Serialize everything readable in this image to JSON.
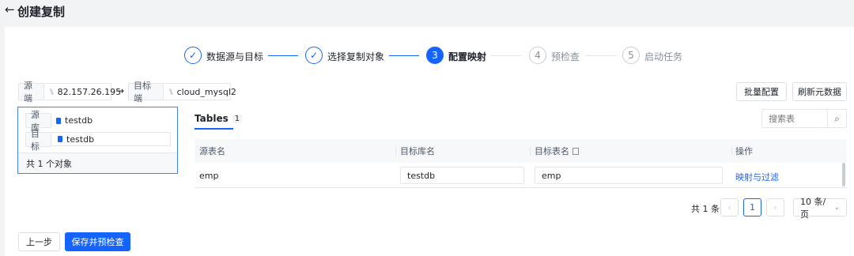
{
  "header": {
    "back_icon": "←",
    "title": "创建复制"
  },
  "steps": [
    {
      "label": "数据源与目标",
      "state": "done",
      "mark": "✓"
    },
    {
      "label": "选择复制对象",
      "state": "done",
      "mark": "✓"
    },
    {
      "label": "配置映射",
      "state": "active",
      "mark": "3"
    },
    {
      "label": "预检查",
      "state": "pending",
      "mark": "4"
    },
    {
      "label": "启动任务",
      "state": "pending",
      "mark": "5"
    }
  ],
  "connection": {
    "source_label": "源端",
    "source_value": "82.157.26.195",
    "arrow": "→",
    "target_label": "目标端",
    "target_value": "cloud_mysql2",
    "link_icon": "⑊"
  },
  "actions": {
    "batch_config": "批量配置",
    "refresh_meta": "刷新元数据"
  },
  "left_panel": {
    "source_db_label": "源库",
    "source_db_value": "testdb",
    "target_label": "目标",
    "target_value": "testdb",
    "footer": "共 1 个对象"
  },
  "tables_tab": {
    "label": "Tables",
    "count": "1"
  },
  "search": {
    "placeholder": "搜索表",
    "icon": "⌕"
  },
  "table": {
    "columns": [
      "源表名",
      "目标库名",
      "目标表名",
      "操作"
    ],
    "rows": [
      {
        "source_table": "emp",
        "target_db": "testdb",
        "target_table": "emp",
        "action": "映射与过滤"
      }
    ]
  },
  "pagination": {
    "total": "共 1 条",
    "prev": "‹",
    "page": "1",
    "next": "›",
    "page_size": "10 条/页"
  },
  "footer": {
    "prev_step": "上一步",
    "save_check": "保存并预检查"
  },
  "colors": {
    "primary": "#1664ff",
    "border": "#e5e6eb",
    "bg": "#f2f3f5"
  }
}
